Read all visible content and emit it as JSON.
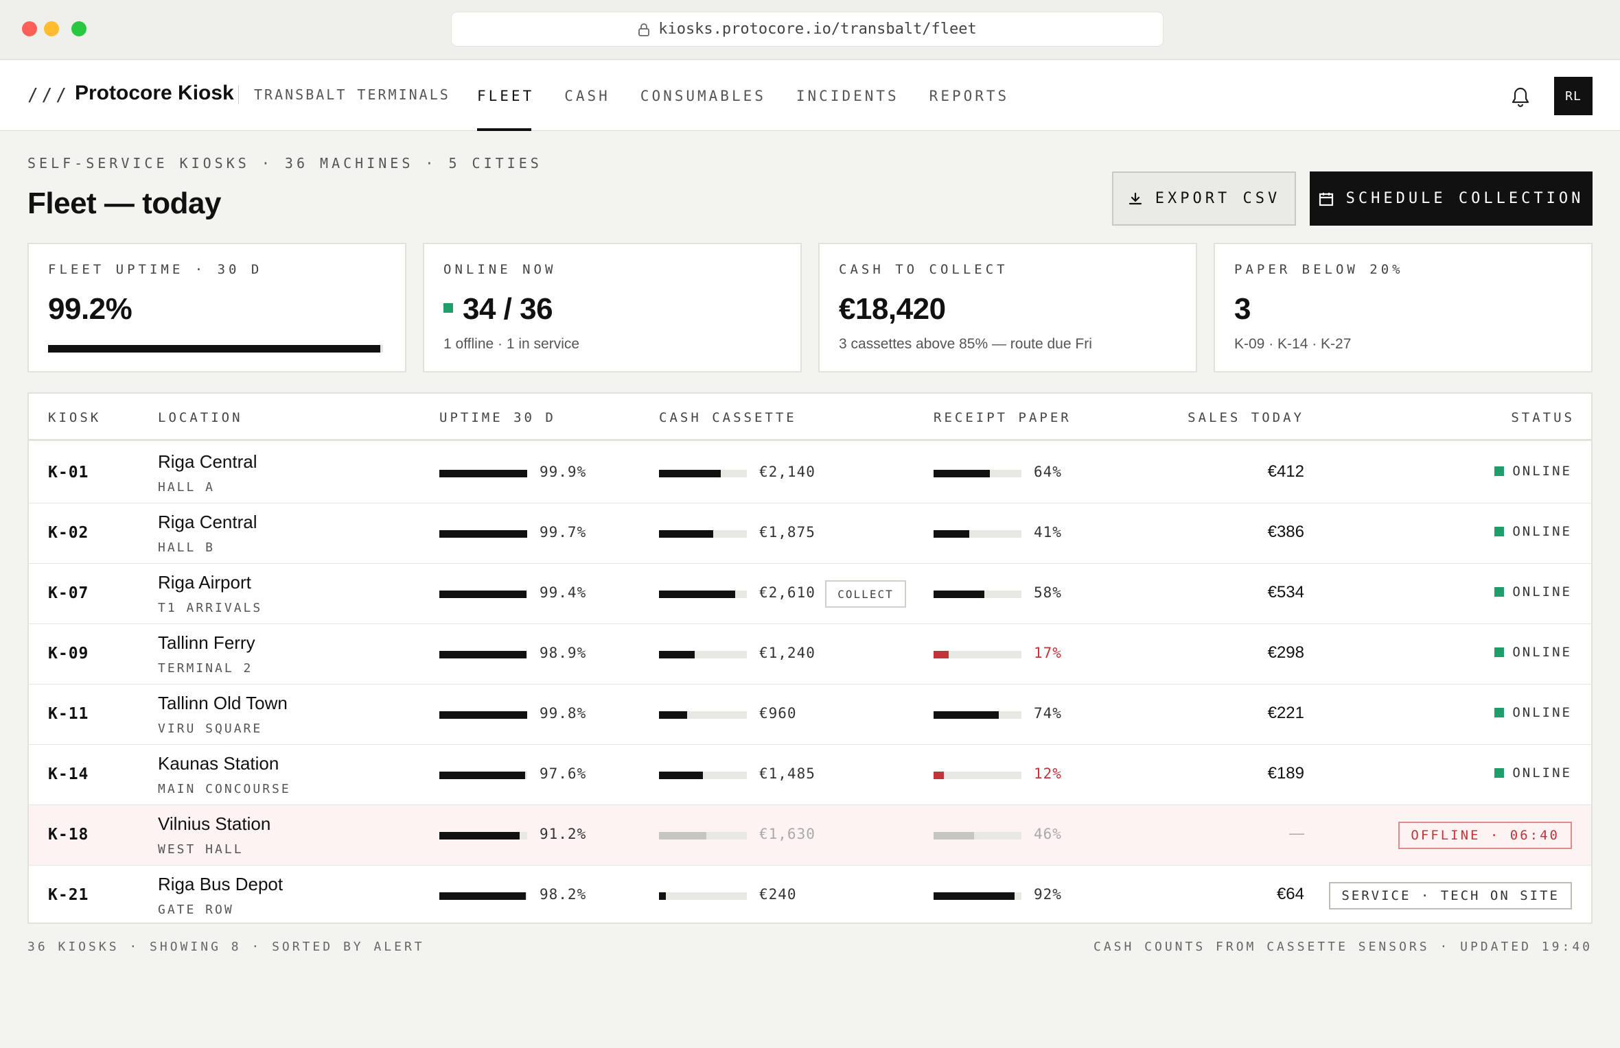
{
  "browser": {
    "url": "kiosks.protocore.io/transbalt/fleet"
  },
  "header": {
    "brand_mark": "///",
    "brand_name": "Protocore Kiosk",
    "org": "TRANSBALT TERMINALS",
    "nav": [
      "FLEET",
      "CASH",
      "CONSUMABLES",
      "INCIDENTS",
      "REPORTS"
    ],
    "active_nav": "FLEET",
    "avatar_initials": "RL"
  },
  "page": {
    "eyebrow": "SELF-SERVICE KIOSKS · 36 MACHINES · 5 CITIES",
    "title": "Fleet — today",
    "export_label": "EXPORT CSV",
    "schedule_label": "SCHEDULE COLLECTION"
  },
  "kpis": {
    "uptime": {
      "label": "FLEET UPTIME · 30 D",
      "value": "99.2%",
      "bar_fraction": 0.992
    },
    "online": {
      "label": "ONLINE NOW",
      "value": "34 / 36",
      "sub": "1 offline · 1 in service"
    },
    "cash": {
      "label": "CASH TO COLLECT",
      "value": "€18,420",
      "sub": "3 cassettes above 85% — route due Fri"
    },
    "paper": {
      "label": "PAPER BELOW 20%",
      "value": "3",
      "sub": "K-09 · K-14 · K-27"
    }
  },
  "table": {
    "headers": {
      "kiosk": "KIOSK",
      "location": "LOCATION",
      "uptime": "UPTIME 30 D",
      "cash": "CASH CASSETTE",
      "paper": "RECEIPT PAPER",
      "sales": "SALES TODAY",
      "status": "STATUS"
    },
    "rows": [
      {
        "id": "K-01",
        "location": "Riga Central",
        "sub": "HALL A",
        "uptime": "99.9%",
        "uptime_frac": 0.999,
        "cash": "€2,140",
        "cash_frac": 0.7,
        "paper": "64%",
        "paper_frac": 0.64,
        "sales": "€412",
        "status": "ONLINE"
      },
      {
        "id": "K-02",
        "location": "Riga Central",
        "sub": "HALL B",
        "uptime": "99.7%",
        "uptime_frac": 0.997,
        "cash": "€1,875",
        "cash_frac": 0.62,
        "paper": "41%",
        "paper_frac": 0.41,
        "sales": "€386",
        "status": "ONLINE"
      },
      {
        "id": "K-07",
        "location": "Riga Airport",
        "sub": "T1 ARRIVALS",
        "uptime": "99.4%",
        "uptime_frac": 0.994,
        "cash": "€2,610",
        "cash_frac": 0.87,
        "cash_tag": "COLLECT",
        "paper": "58%",
        "paper_frac": 0.58,
        "sales": "€534",
        "status": "ONLINE"
      },
      {
        "id": "K-09",
        "location": "Tallinn Ferry",
        "sub": "TERMINAL 2",
        "uptime": "98.9%",
        "uptime_frac": 0.989,
        "cash": "€1,240",
        "cash_frac": 0.41,
        "paper": "17%",
        "paper_frac": 0.17,
        "paper_low": true,
        "sales": "€298",
        "status": "ONLINE"
      },
      {
        "id": "K-11",
        "location": "Tallinn Old Town",
        "sub": "VIRU SQUARE",
        "uptime": "99.8%",
        "uptime_frac": 0.998,
        "cash": "€960",
        "cash_frac": 0.32,
        "paper": "74%",
        "paper_frac": 0.74,
        "sales": "€221",
        "status": "ONLINE"
      },
      {
        "id": "K-14",
        "location": "Kaunas Station",
        "sub": "MAIN CONCOURSE",
        "uptime": "97.6%",
        "uptime_frac": 0.976,
        "cash": "€1,485",
        "cash_frac": 0.5,
        "paper": "12%",
        "paper_frac": 0.12,
        "paper_low": true,
        "sales": "€189",
        "status": "ONLINE"
      },
      {
        "id": "K-18",
        "location": "Vilnius Station",
        "sub": "WEST HALL",
        "uptime": "91.2%",
        "uptime_frac": 0.912,
        "cash": "€1,630",
        "cash_frac": 0.54,
        "paper": "46%",
        "paper_frac": 0.46,
        "muted": true,
        "sales": "—",
        "status": "OFFLINE · 06:40"
      },
      {
        "id": "K-21",
        "location": "Riga Bus Depot",
        "sub": "GATE ROW",
        "uptime": "98.2%",
        "uptime_frac": 0.982,
        "cash": "€240",
        "cash_frac": 0.08,
        "paper": "92%",
        "paper_frac": 0.92,
        "sales": "€64",
        "status": "SERVICE · TECH ON SITE"
      }
    ]
  },
  "footer": {
    "left": "36 KIOSKS · SHOWING 8 · SORTED BY ALERT",
    "right": "CASH COUNTS FROM CASSETTE SENSORS · UPDATED 19:40"
  },
  "icons": {
    "lock": "lock-icon",
    "bell": "bell-icon",
    "download": "download-icon",
    "calendar": "calendar-icon"
  },
  "colors": {
    "online": "#1f9d6b",
    "alert": "#c4323a",
    "ink": "#111111"
  }
}
